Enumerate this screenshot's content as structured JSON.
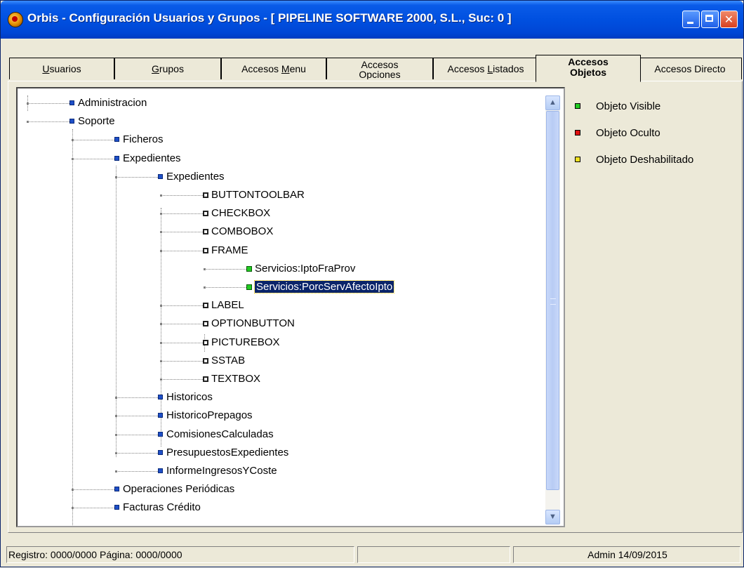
{
  "window": {
    "title": "Orbis - Configuración Usuarios y Grupos - [ PIPELINE SOFTWARE 2000, S.L.,  Suc: 0 ]",
    "controls": [
      "minimize-icon",
      "maximize-icon",
      "close-icon"
    ]
  },
  "tabs": [
    {
      "pre": "",
      "key": "U",
      "post": "suarios"
    },
    {
      "pre": "",
      "key": "G",
      "post": "rupos"
    },
    {
      "pre": "Accesos ",
      "key": "M",
      "post": "enu"
    },
    {
      "label": "Accesos Opciones"
    },
    {
      "pre": "Accesos ",
      "key": "L",
      "post": "istados"
    },
    {
      "label": "Accesos Objetos",
      "active": true
    },
    {
      "label": "Accesos Directo"
    }
  ],
  "tree": {
    "items": [
      {
        "label": "Administracion",
        "icon": "folder"
      },
      {
        "label": "Soporte",
        "icon": "folder"
      },
      {
        "label": "Ficheros",
        "icon": "folder"
      },
      {
        "label": "Expedientes",
        "icon": "folder"
      },
      {
        "label": "Expedientes",
        "icon": "folder"
      },
      {
        "label": "BUTTONTOOLBAR",
        "icon": "object"
      },
      {
        "label": "CHECKBOX",
        "icon": "object"
      },
      {
        "label": "COMBOBOX",
        "icon": "object"
      },
      {
        "label": "FRAME",
        "icon": "object"
      },
      {
        "label": "Servicios:IptoFraProv",
        "icon": "visible"
      },
      {
        "label": "Servicios:PorcServAfectoIpto",
        "icon": "visible",
        "selected": true
      },
      {
        "label": "LABEL",
        "icon": "object"
      },
      {
        "label": "OPTIONBUTTON",
        "icon": "object"
      },
      {
        "label": "PICTUREBOX",
        "icon": "object"
      },
      {
        "label": "SSTAB",
        "icon": "object"
      },
      {
        "label": "TEXTBOX",
        "icon": "object"
      },
      {
        "label": "Historicos",
        "icon": "folder"
      },
      {
        "label": "HistoricoPrepagos",
        "icon": "folder"
      },
      {
        "label": "ComisionesCalculadas",
        "icon": "folder"
      },
      {
        "label": "PresupuestosExpedientes",
        "icon": "folder"
      },
      {
        "label": "InformeIngresosYCoste",
        "icon": "folder"
      },
      {
        "label": "Operaciones Periódicas",
        "icon": "folder"
      },
      {
        "label": "Facturas Crédito",
        "icon": "folder"
      }
    ]
  },
  "legend": [
    {
      "label": "Objeto Visible",
      "color": "#22CC22"
    },
    {
      "label": "Objeto Oculto",
      "color": "#E01010"
    },
    {
      "label": "Objeto Deshabilitado",
      "color": "#F0E020"
    }
  ],
  "status": {
    "registro": "Registro: 0000/0000  Página: 0000/0000",
    "middle": "",
    "user": "Admin 14/09/2015"
  }
}
